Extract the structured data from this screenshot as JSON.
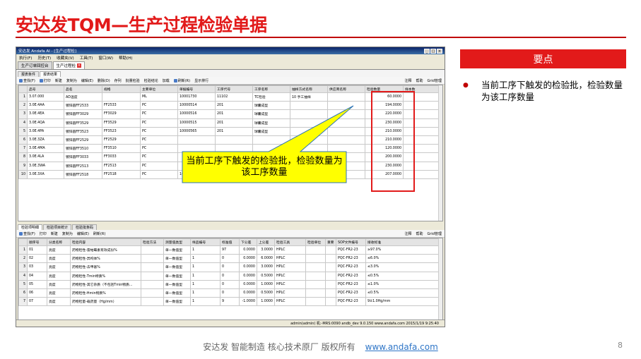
{
  "slide": {
    "title": "安达发TQM—生产过程检验单据",
    "side_header": "要点",
    "side_text": "当前工序下触发的检验批，检验数量为该工序数量",
    "callout_text": "当前工序下触发的检验批，检验数量为该工序数量",
    "footer_text": "安达发   智能制造 核心技术原厂   版权所有",
    "footer_link": "www.andafa.com",
    "page_number": "8"
  },
  "window": {
    "title": "安达发 Andafa AI - [生产过程检]",
    "controls": [
      "_",
      "□",
      "×"
    ],
    "menu": [
      "执行(F)",
      "历史(T)",
      "收藏夹(V)",
      "工具(T)",
      "窗口(W)",
      "帮助(H)"
    ],
    "tabs": [
      "生产订单回控台",
      "生产过程检"
    ],
    "subtabs": [
      "报表条件",
      "报表结果"
    ],
    "toolbar": [
      "查找(F)",
      "打印",
      "新建",
      "复制为",
      "编辑(E)",
      "删除(D)",
      "存列",
      "批量检验",
      "检验结论",
      "加载",
      "刷新(R)",
      "显示排行"
    ],
    "toolbar_right": [
      "注释",
      "帮助",
      "Grid管理"
    ],
    "status": "admin(admin)  机:-MRS:0090  andb_dev  9.0.150  www.andafa.com  2015/1/19 9:25:40"
  },
  "grid1": {
    "columns": [
      "",
      "品号",
      "品名",
      "规格",
      "主要单位",
      "单据编号",
      "工序代号",
      "工序名称",
      "抽样方式名称",
      "供应商名称",
      "检验数量",
      "样本数"
    ],
    "rows": [
      [
        "1",
        "3.07.000",
        "AD温度",
        "",
        "ML",
        "10001730",
        "11102",
        "TC检验",
        "10 手工抽样",
        "",
        "60.0000",
        ""
      ],
      [
        "2",
        "3.0E.4AA",
        "镀锌圆FF2533",
        "FF2533",
        "PC",
        "10000514",
        "201",
        "球囊成型",
        "",
        "",
        "194.0000",
        ""
      ],
      [
        "3",
        "3.0E.4EA",
        "镀锌圆FF3029",
        "FF3029",
        "PC",
        "10000516",
        "201",
        "球囊成型",
        "",
        "",
        "220.0000",
        ""
      ],
      [
        "4",
        "3.0E.4QA",
        "镀锌圆FF3529",
        "FF3529",
        "PC",
        "10000515",
        "201",
        "球囊成型",
        "",
        "",
        "230.0000",
        ""
      ],
      [
        "5",
        "3.0E.4PA",
        "镀锌圆FF3523",
        "FF3523",
        "PC",
        "10000565",
        "201",
        "球囊成型",
        "",
        "",
        "210.0000",
        ""
      ],
      [
        "6",
        "3.0E.3ZA",
        "镀锌圆FF2529",
        "FF2529",
        "PC",
        "",
        "",
        "",
        "",
        "",
        "210.0000",
        ""
      ],
      [
        "7",
        "3.0E.4MA",
        "镀锌圆FF3510",
        "FF3510",
        "PC",
        "",
        "",
        "",
        "",
        "",
        "120.0000",
        ""
      ],
      [
        "8",
        "3.0E.4LA",
        "镀锌圆FF3033",
        "FF3033",
        "PC",
        "",
        "",
        "",
        "",
        "",
        "200.0000",
        ""
      ],
      [
        "9",
        "3.0E.3WA",
        "镀锌圆FF2513",
        "FF2513",
        "PC",
        "",
        "",
        "",
        "",
        "",
        "230.0000",
        ""
      ],
      [
        "10",
        "3.0E.3XA",
        "镀锌圆FF2518",
        "FF2518",
        "PC",
        "10000517",
        "201",
        "球囊成型",
        "",
        "",
        "207.0000",
        ""
      ]
    ]
  },
  "lower_tabs": [
    "检验项明细",
    "检验项目统计",
    "检验批条码"
  ],
  "toolbar2": [
    "查找(F)",
    "打印",
    "新建",
    "复制为",
    "编辑(E)",
    "刷新(R)"
  ],
  "toolbar2_right": [
    "注释",
    "帮助",
    "Grid管理"
  ],
  "grid2": {
    "columns": [
      "",
      "顺序号",
      "分类名称",
      "检验内容",
      "检验方法",
      "测量值类型",
      "样品编号",
      "标准值",
      "下公差",
      "上公差",
      "检验工具",
      "检验单位",
      "重要",
      "SOP文件编号",
      "接收标准"
    ],
    "rows": [
      [
        "1",
        "01",
        "亮度",
        "药物检性-雷帕霉素有效成份%",
        "",
        "单一数值型",
        "1",
        "97",
        "0.0000",
        "3.0000",
        "HPLC",
        "",
        "",
        "PQC-FR2-23",
        "≥97.0%"
      ],
      [
        "2",
        "02",
        "亮度",
        "药物检性-异构体%",
        "",
        "单一数值型",
        "1",
        "0",
        "0.0000",
        "6.0000",
        "HPLC",
        "",
        "",
        "PQC-FR2-23",
        "≤6.0%"
      ],
      [
        "3",
        "03",
        "亮度",
        "药物检性-去甲基%",
        "",
        "单一数值型",
        "1",
        "0",
        "0.0000",
        "3.0000",
        "HPLC",
        "",
        "",
        "PQC-FR2-23",
        "≤3.0%"
      ],
      [
        "4",
        "04",
        "亮度",
        "药物检性-Tmin特质%",
        "",
        "单一数值型",
        "1",
        "0",
        "0.0000",
        "0.5000",
        "HPLC",
        "",
        "",
        "PQC-FR2-23",
        "≤0.5%"
      ],
      [
        "5",
        "05",
        "亮度",
        "药物检性-其它杂质（不包括Tmin物质...",
        "",
        "单一数值型",
        "1",
        "0",
        "0.0000",
        "1.0000",
        "HPLC",
        "",
        "",
        "PQC-FR2-23",
        "≤1.0%"
      ],
      [
        "6",
        "06",
        "亮度",
        "药物检性-Hmin物质%",
        "",
        "单一数值型",
        "1",
        "0",
        "0.0000",
        "0.5000",
        "HPLC",
        "",
        "",
        "PQC-FR2-23",
        "≤0.5%"
      ],
      [
        "7",
        "07",
        "亮度",
        "药物检量-载药量（Hg/mm）",
        "",
        "单一数值型",
        "1",
        "9",
        "-1.0000",
        "1.0000",
        "HPLC",
        "",
        "",
        "PQC-FR2-23",
        "9±1.0Hg/mm"
      ]
    ]
  },
  "colors": {
    "accent": "#e21a1a",
    "callout_fill": "#ffff00",
    "callout_border": "#2e75b6"
  }
}
